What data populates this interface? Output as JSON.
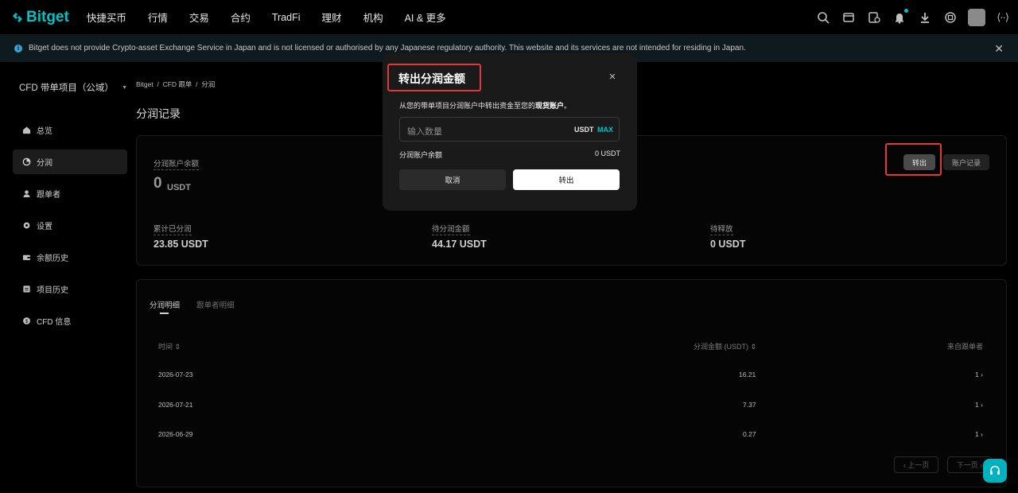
{
  "brand": {
    "name": "Bitget",
    "accent": "#00c2c7"
  },
  "nav": {
    "items": [
      "快捷买币",
      "行情",
      "交易",
      "合约",
      "TradFi",
      "理财",
      "机构",
      "AI & 更多"
    ],
    "lang_glyph": "⟨··⟩"
  },
  "banner": {
    "text": "Bitget does not provide Crypto-asset Exchange Service in Japan and is not licensed or authorised by any Japanese regulatory authority. This website and its services are not intended for residing in Japan."
  },
  "sidebar": {
    "title": "CFD 带单项目（公域）",
    "items": [
      {
        "label": "总览",
        "icon": "home-icon"
      },
      {
        "label": "分润",
        "icon": "pie-chart-icon"
      },
      {
        "label": "跟单者",
        "icon": "user-icon"
      },
      {
        "label": "设置",
        "icon": "gear-icon"
      },
      {
        "label": "余额历史",
        "icon": "wallet-icon"
      },
      {
        "label": "项目历史",
        "icon": "history-icon"
      },
      {
        "label": "CFD 信息",
        "icon": "coin-icon"
      }
    ]
  },
  "breadcrumb": {
    "a": "Bitget",
    "b": "CFD 跟单",
    "c": "分润",
    "sep": "/"
  },
  "page_title": "分润记录",
  "balance": {
    "title": "分润账户余额",
    "value": "0",
    "unit": "USDT",
    "transfer_label": "转出",
    "records_label": "账户记录"
  },
  "stats": [
    {
      "label": "累计已分润",
      "value": "23.85 USDT"
    },
    {
      "label": "待分润金额",
      "value": "44.17 USDT"
    },
    {
      "label": "待释放",
      "value": "0 USDT"
    }
  ],
  "tabs": {
    "active": "分润明细",
    "inactive": "跟单者明细"
  },
  "table": {
    "headers": {
      "time": "时间 ⇕",
      "amount": "分润金额 (USDT) ⇕",
      "from": "来自跟单者"
    },
    "rows": [
      {
        "date": "2026-07-23",
        "amount": "16.21",
        "from": "1 ›"
      },
      {
        "date": "2026-07-21",
        "amount": "7.37",
        "from": "1 ›"
      },
      {
        "date": "2026-06-29",
        "amount": "0.27",
        "from": "1 ›"
      }
    ]
  },
  "pagination": {
    "prev": "‹ 上一页",
    "next": "下一页 ›"
  },
  "modal": {
    "title": "转出分润金额",
    "desc_prefix": "从您的带单项目分润账户中转出资金至您的",
    "desc_strong": "现货账户",
    "desc_suffix": "。",
    "placeholder": "输入数量",
    "unit": "USDT",
    "max": "MAX",
    "balance_label": "分润账户余额",
    "balance_value": "0 USDT",
    "cancel": "取消",
    "confirm": "转出",
    "close": "×"
  }
}
